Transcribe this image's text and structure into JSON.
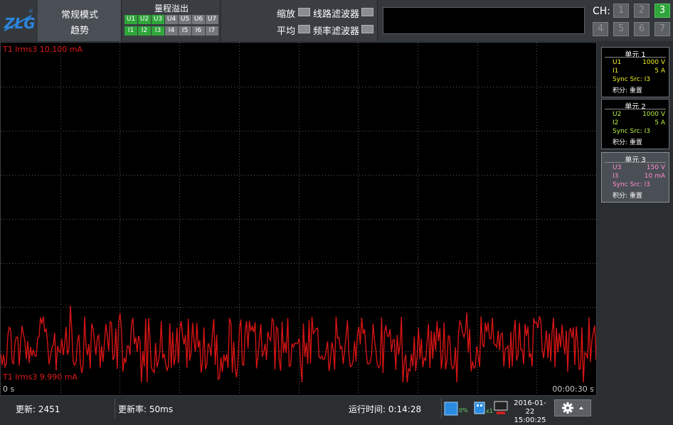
{
  "header": {
    "logo_text": "ZLG",
    "mode_line1": "常规模式",
    "mode_line2": "趋势",
    "range_title": "量程溢出",
    "u_chips": [
      {
        "label": "U1",
        "on": true
      },
      {
        "label": "U2",
        "on": true
      },
      {
        "label": "U3",
        "on": true
      },
      {
        "label": "U4",
        "on": false
      },
      {
        "label": "U5",
        "on": false
      },
      {
        "label": "U6",
        "on": false
      },
      {
        "label": "U7",
        "on": false
      }
    ],
    "i_chips": [
      {
        "label": "I1",
        "on": true
      },
      {
        "label": "I2",
        "on": true
      },
      {
        "label": "I3",
        "on": true
      },
      {
        "label": "I4",
        "on": false
      },
      {
        "label": "I5",
        "on": false
      },
      {
        "label": "I6",
        "on": false
      },
      {
        "label": "I7",
        "on": false
      }
    ],
    "zoom_label": "缩放",
    "line_filter_label": "线路滤波器",
    "avg_label": "平均",
    "freq_filter_label": "频率滤波器",
    "message": ""
  },
  "channels": {
    "label": "CH:",
    "buttons": [
      "1",
      "2",
      "3",
      "4",
      "5",
      "6",
      "7"
    ],
    "active": "3"
  },
  "plot": {
    "top_label": "T1 Irms3  10.100 mA",
    "bottom_label": "T1 Irms3  9.990 mA",
    "time_start": "0 s",
    "time_end": "00:00:30 s",
    "trace_color": "#d41414",
    "label_color": "#e01a1a"
  },
  "units": [
    {
      "title": "单元 1",
      "rows": [
        [
          "U1",
          "1000 V"
        ],
        [
          "I1",
          "5 A"
        ]
      ],
      "sync": "Sync Src: I3",
      "integ": "积分: 重置",
      "color": "#f0f020"
    },
    {
      "title": "单元 2",
      "rows": [
        [
          "U2",
          "1000 V"
        ],
        [
          "I2",
          "5 A"
        ]
      ],
      "sync": "Sync Src: I3",
      "integ": "积分: 重置",
      "color": "#b8f040"
    },
    {
      "title": "单元 3",
      "rows": [
        [
          "U3",
          "150 V"
        ],
        [
          "I3",
          "10 mA"
        ]
      ],
      "sync": "Sync Src: I3",
      "integ": "积分: 重置",
      "color": "#ff8cd0"
    }
  ],
  "status": {
    "update_label": "更新: 2451",
    "rate_label": "更新率: 50ms",
    "runtime_label": "运行时间: 0:14:28",
    "storage_pct": "0%",
    "usb_count": "x1",
    "date": "2016-01-22",
    "time": "15:00:25"
  }
}
